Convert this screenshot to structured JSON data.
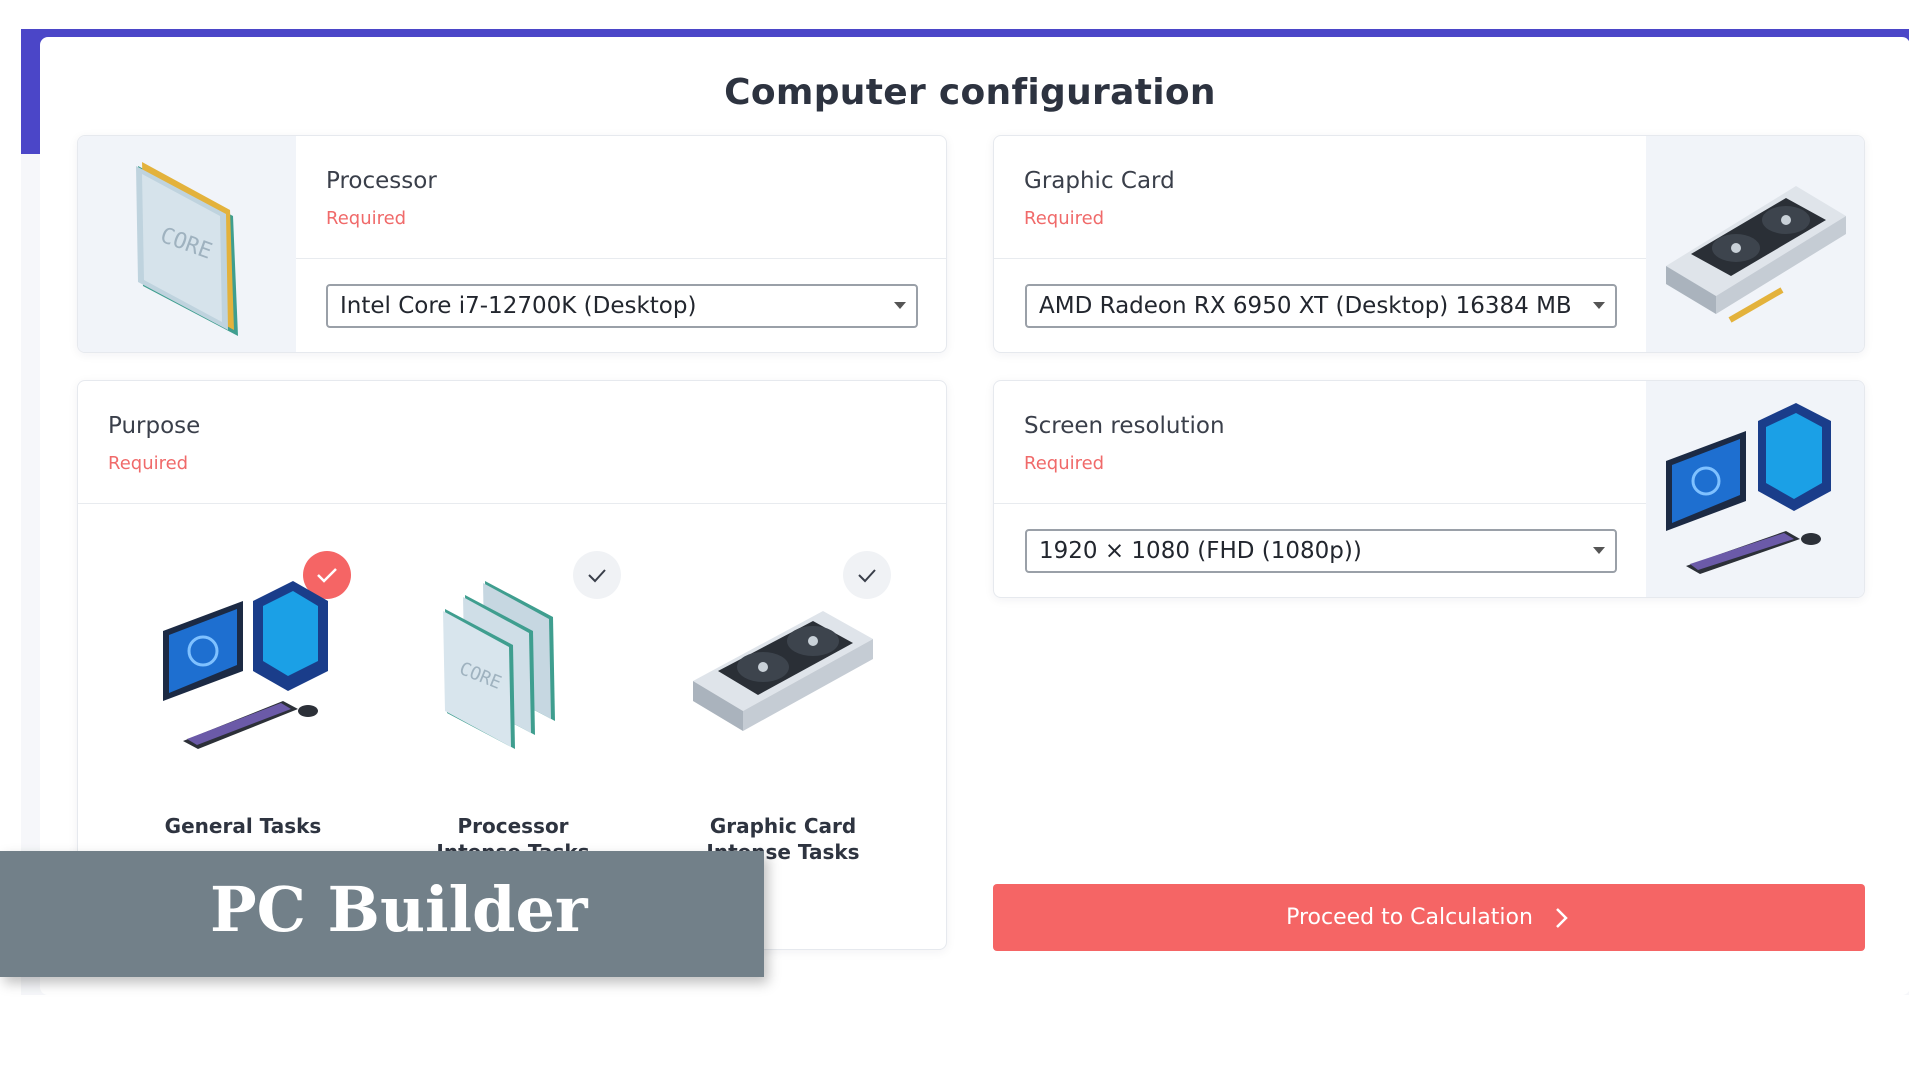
{
  "page": {
    "title": "Computer configuration"
  },
  "processor": {
    "label": "Processor",
    "required": "Required",
    "value": "Intel Core i7-12700K (Desktop)"
  },
  "graphic_card": {
    "label": "Graphic Card",
    "required": "Required",
    "value": "AMD Radeon RX 6950 XT (Desktop) 16384 MB"
  },
  "purpose": {
    "label": "Purpose",
    "required": "Required",
    "options": [
      {
        "line1": "General Tasks",
        "line2": "",
        "selected": true
      },
      {
        "line1": "Processor",
        "line2": "Intense Tasks",
        "selected": false
      },
      {
        "line1": "Graphic Card",
        "line2": "Intense Tasks",
        "selected": false
      }
    ]
  },
  "resolution": {
    "label": "Screen resolution",
    "required": "Required",
    "value": "1920 × 1080 (FHD (1080p))"
  },
  "cta": {
    "label": "Proceed to Calculation"
  },
  "banner": {
    "text": "PC Builder"
  },
  "colors": {
    "accent": "#f56565",
    "band": "#4b46c8",
    "banner": "#728089"
  }
}
